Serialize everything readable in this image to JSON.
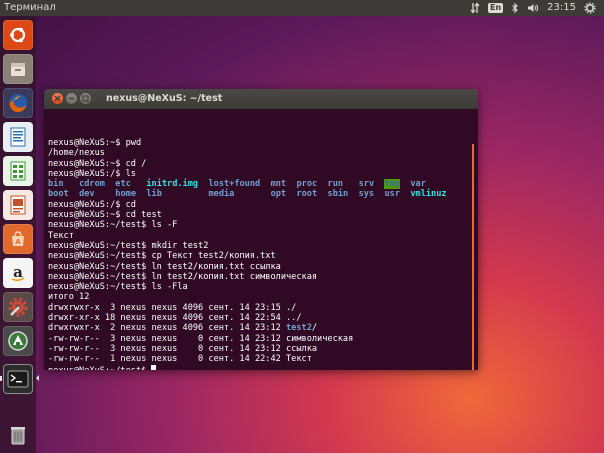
{
  "top_panel": {
    "app_title": "Терминал",
    "keyboard_layout": "En",
    "clock": "23:15"
  },
  "launcher": {
    "items": [
      {
        "name": "dash-icon",
        "color": "#dd4814"
      },
      {
        "name": "files-icon",
        "color": "#a39b8f"
      },
      {
        "name": "firefox-icon",
        "color": "#e66000"
      },
      {
        "name": "writer-icon",
        "color": "#2a6bb6"
      },
      {
        "name": "calc-icon",
        "color": "#3d9b35"
      },
      {
        "name": "impress-icon",
        "color": "#c4502a"
      },
      {
        "name": "software-center-icon",
        "color": "#e0692b"
      },
      {
        "name": "amazon-icon",
        "color": "#f5f5f5"
      },
      {
        "name": "system-settings-icon",
        "color": "#c94a3a"
      },
      {
        "name": "software-updater-icon",
        "color": "#5a5a5a"
      },
      {
        "name": "terminal-icon",
        "color": "#2c2c2c"
      },
      {
        "name": "trash-icon",
        "color": "#8c8c8c"
      }
    ]
  },
  "window": {
    "title": "nexus@NeXuS: ~/test"
  },
  "terminal": {
    "lines": [
      [
        {
          "t": "nexus@NeXuS:~$ pwd",
          "c": "c-prompt"
        }
      ],
      [
        {
          "t": "/home/nexus",
          "c": "c-prompt"
        }
      ],
      [
        {
          "t": "nexus@NeXuS:~$ cd /",
          "c": "c-prompt"
        }
      ],
      [
        {
          "t": "nexus@NeXuS:/$ ls",
          "c": "c-prompt"
        }
      ],
      [
        {
          "t": "bin",
          "c": "c-dir"
        },
        {
          "t": "   ",
          "c": ""
        },
        {
          "t": "cdrom",
          "c": "c-dir"
        },
        {
          "t": "  ",
          "c": ""
        },
        {
          "t": "etc",
          "c": "c-dir"
        },
        {
          "t": "   ",
          "c": ""
        },
        {
          "t": "initrd.img",
          "c": "c-link"
        },
        {
          "t": "  ",
          "c": ""
        },
        {
          "t": "lost+found",
          "c": "c-dir"
        },
        {
          "t": "  ",
          "c": ""
        },
        {
          "t": "mnt",
          "c": "c-dir"
        },
        {
          "t": "  ",
          "c": ""
        },
        {
          "t": "proc",
          "c": "c-dir"
        },
        {
          "t": "  ",
          "c": ""
        },
        {
          "t": "run",
          "c": "c-dir"
        },
        {
          "t": "   ",
          "c": ""
        },
        {
          "t": "srv",
          "c": "c-dir"
        },
        {
          "t": "  ",
          "c": ""
        },
        {
          "t": "tmp",
          "c": "c-sticky"
        },
        {
          "t": "  ",
          "c": ""
        },
        {
          "t": "var",
          "c": "c-dir"
        }
      ],
      [
        {
          "t": "boot",
          "c": "c-dir"
        },
        {
          "t": "  ",
          "c": ""
        },
        {
          "t": "dev",
          "c": "c-dir"
        },
        {
          "t": "    ",
          "c": ""
        },
        {
          "t": "home",
          "c": "c-dir"
        },
        {
          "t": "  ",
          "c": ""
        },
        {
          "t": "lib",
          "c": "c-dir"
        },
        {
          "t": "         ",
          "c": ""
        },
        {
          "t": "media",
          "c": "c-dir"
        },
        {
          "t": "       ",
          "c": ""
        },
        {
          "t": "opt",
          "c": "c-dir"
        },
        {
          "t": "  ",
          "c": ""
        },
        {
          "t": "root",
          "c": "c-dir"
        },
        {
          "t": "  ",
          "c": ""
        },
        {
          "t": "sbin",
          "c": "c-dir"
        },
        {
          "t": "  ",
          "c": ""
        },
        {
          "t": "sys",
          "c": "c-dir"
        },
        {
          "t": "  ",
          "c": ""
        },
        {
          "t": "usr",
          "c": "c-dir"
        },
        {
          "t": "  ",
          "c": ""
        },
        {
          "t": "vmlinuz",
          "c": "c-link"
        }
      ],
      [
        {
          "t": "nexus@NeXuS:/$ cd",
          "c": "c-prompt"
        }
      ],
      [
        {
          "t": "nexus@NeXuS:~$ cd test",
          "c": "c-prompt"
        }
      ],
      [
        {
          "t": "nexus@NeXuS:~/test$ ls -F",
          "c": "c-prompt"
        }
      ],
      [
        {
          "t": "Текст",
          "c": "c-prompt"
        }
      ],
      [
        {
          "t": "nexus@NeXuS:~/test$ mkdir test2",
          "c": "c-prompt"
        }
      ],
      [
        {
          "t": "nexus@NeXuS:~/test$ cp Текст test2/копия.txt",
          "c": "c-prompt"
        }
      ],
      [
        {
          "t": "nexus@NeXuS:~/test$ ln test2/копия.txt ссылка",
          "c": "c-prompt"
        }
      ],
      [
        {
          "t": "nexus@NeXuS:~/test$ ln test2/копия.txt символическая",
          "c": "c-prompt"
        }
      ],
      [
        {
          "t": "nexus@NeXuS:~/test$ ls -Fla",
          "c": "c-prompt"
        }
      ],
      [
        {
          "t": "итого 12",
          "c": "c-prompt"
        }
      ],
      [
        {
          "t": "drwxrwxr-x  3 nexus nexus 4096 сент. 14 23:15 ./",
          "c": "c-prompt"
        }
      ],
      [
        {
          "t": "drwxr-xr-x 18 nexus nexus 4096 сент. 14 22:54 ../",
          "c": "c-prompt"
        }
      ],
      [
        {
          "t": "drwxrwxr-x  2 nexus nexus 4096 сент. 14 23:12 ",
          "c": "c-prompt"
        },
        {
          "t": "test2",
          "c": "c-dir"
        },
        {
          "t": "/",
          "c": "c-prompt"
        }
      ],
      [
        {
          "t": "-rw-rw-r--  3 nexus nexus    0 сент. 14 23:12 символическая",
          "c": "c-prompt"
        }
      ],
      [
        {
          "t": "-rw-rw-r--  3 nexus nexus    0 сент. 14 23:12 ссылка",
          "c": "c-prompt"
        }
      ],
      [
        {
          "t": "-rw-rw-r--  1 nexus nexus    0 сент. 14 22:42 Текст",
          "c": "c-prompt"
        }
      ],
      [
        {
          "t": "nexus@NeXuS:~/test$ ",
          "c": "c-prompt"
        }
      ]
    ]
  }
}
